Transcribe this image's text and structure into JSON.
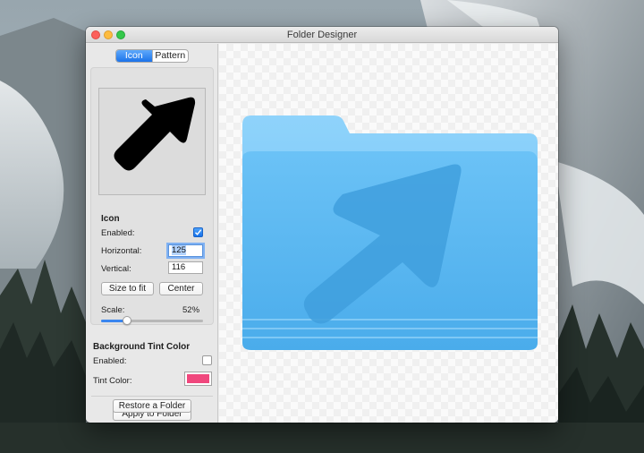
{
  "window": {
    "title": "Folder Designer"
  },
  "tabs": [
    {
      "label": "Icon",
      "selected": true
    },
    {
      "label": "Pattern",
      "selected": false
    }
  ],
  "icon_section": {
    "heading": "Icon",
    "enabled_label": "Enabled:",
    "enabled": true,
    "horizontal_label": "Horizontal:",
    "horizontal_value": "125",
    "vertical_label": "Vertical:",
    "vertical_value": "116",
    "size_to_fit_label": "Size to fit",
    "center_label": "Center",
    "scale_label": "Scale:",
    "scale_value": "52%",
    "scale_fraction": 0.25
  },
  "tint_section": {
    "heading": "Background Tint Color",
    "enabled_label": "Enabled:",
    "enabled": false,
    "tint_color_label": "Tint Color:",
    "tint_color": "#f0477d"
  },
  "actions": {
    "apply_label": "Apply to Folder",
    "restore_label": "Restore a Folder"
  },
  "icons": {
    "preview_icon": "arrow-up-right-icon",
    "folder": "folder-icon"
  },
  "colors": {
    "accent": "#1b73ea",
    "folder_blue": "#6cc4f5"
  }
}
